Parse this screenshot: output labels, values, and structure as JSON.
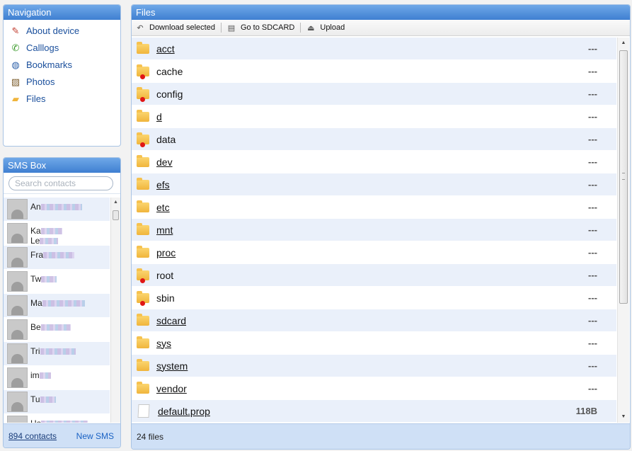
{
  "navigation": {
    "title": "Navigation",
    "items": [
      {
        "label": "About device",
        "icon": "about-device-icon",
        "glyph": "✎",
        "color": "#c0392b"
      },
      {
        "label": "Calllogs",
        "icon": "phone-icon",
        "glyph": "✆",
        "color": "#3a9a2a"
      },
      {
        "label": "Bookmarks",
        "icon": "globe-icon",
        "glyph": "◍",
        "color": "#2b5fa8"
      },
      {
        "label": "Photos",
        "icon": "photo-icon",
        "glyph": "▨",
        "color": "#7a5a28"
      },
      {
        "label": "Files",
        "icon": "folder-icon",
        "glyph": "▰",
        "color": "#f0b53c"
      }
    ]
  },
  "sms": {
    "title": "SMS Box",
    "search_placeholder": "Search contacts",
    "contacts": [
      {
        "name": "An",
        "line2": ""
      },
      {
        "name": "Ka",
        "line2": "Le"
      },
      {
        "name": "Fra",
        "line2": ""
      },
      {
        "name": "Tw",
        "line2": ""
      },
      {
        "name": "Ma",
        "line2": ""
      },
      {
        "name": "Be",
        "line2": ""
      },
      {
        "name": "Tri",
        "line2": ""
      },
      {
        "name": "im",
        "line2": ""
      },
      {
        "name": "Tu",
        "line2": ""
      },
      {
        "name": "Ha",
        "line2": ""
      }
    ],
    "contacts_count": "894 contacts",
    "new_sms": "New SMS"
  },
  "files": {
    "title": "Files",
    "toolbar": {
      "download": "Download selected",
      "goto_sdcard": "Go to SDCARD",
      "upload": "Upload"
    },
    "rows": [
      {
        "name": "acct",
        "size": "---",
        "type": "folder",
        "restricted": false
      },
      {
        "name": "cache",
        "size": "---",
        "type": "folder",
        "restricted": true
      },
      {
        "name": "config",
        "size": "---",
        "type": "folder",
        "restricted": true
      },
      {
        "name": "d",
        "size": "---",
        "type": "folder",
        "restricted": false
      },
      {
        "name": "data",
        "size": "---",
        "type": "folder",
        "restricted": true
      },
      {
        "name": "dev",
        "size": "---",
        "type": "folder",
        "restricted": false
      },
      {
        "name": "efs",
        "size": "---",
        "type": "folder",
        "restricted": false
      },
      {
        "name": "etc",
        "size": "---",
        "type": "folder",
        "restricted": false
      },
      {
        "name": "mnt",
        "size": "---",
        "type": "folder",
        "restricted": false
      },
      {
        "name": "proc",
        "size": "---",
        "type": "folder",
        "restricted": false
      },
      {
        "name": "root",
        "size": "---",
        "type": "folder",
        "restricted": true
      },
      {
        "name": "sbin",
        "size": "---",
        "type": "folder",
        "restricted": true
      },
      {
        "name": "sdcard",
        "size": "---",
        "type": "folder",
        "restricted": false
      },
      {
        "name": "sys",
        "size": "---",
        "type": "folder",
        "restricted": false
      },
      {
        "name": "system",
        "size": "---",
        "type": "folder",
        "restricted": false
      },
      {
        "name": "vendor",
        "size": "---",
        "type": "folder",
        "restricted": false
      },
      {
        "name": "default.prop",
        "size": "118B",
        "type": "file",
        "restricted": false
      }
    ],
    "footer": "24 files"
  }
}
